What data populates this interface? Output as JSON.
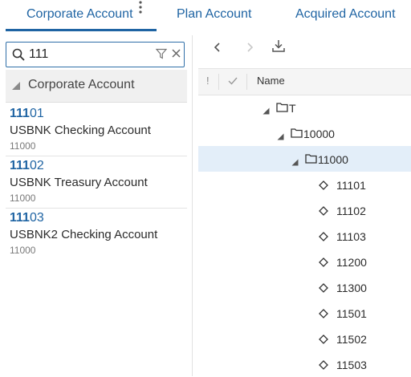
{
  "tabs": [
    {
      "label": "Corporate Account",
      "active": true
    },
    {
      "label": "Plan Account",
      "active": false
    },
    {
      "label": "Acquired Account",
      "active": false
    }
  ],
  "search": {
    "value": "111"
  },
  "left_panel": {
    "header": "Corporate Account",
    "results": [
      {
        "match": "111",
        "rest": "01",
        "name": "USBNK Checking Account",
        "parent": "11000"
      },
      {
        "match": "111",
        "rest": "02",
        "name": "USBNK Treasury Account",
        "parent": "11000"
      },
      {
        "match": "111",
        "rest": "03",
        "name": "USBNK2 Checking Account",
        "parent": "11000"
      }
    ]
  },
  "grid": {
    "col_excl": "!",
    "col_name": "Name"
  },
  "tree": [
    {
      "label": "T",
      "type": "folder",
      "level": 0,
      "selected": false
    },
    {
      "label": "10000",
      "type": "folder",
      "level": 1,
      "selected": false
    },
    {
      "label": "11000",
      "type": "folder",
      "level": 2,
      "selected": true
    },
    {
      "label": "11101",
      "type": "leaf",
      "level": 3,
      "selected": false
    },
    {
      "label": "11102",
      "type": "leaf",
      "level": 3,
      "selected": false
    },
    {
      "label": "11103",
      "type": "leaf",
      "level": 3,
      "selected": false
    },
    {
      "label": "11200",
      "type": "leaf",
      "level": 3,
      "selected": false
    },
    {
      "label": "11300",
      "type": "leaf",
      "level": 3,
      "selected": false
    },
    {
      "label": "11501",
      "type": "leaf",
      "level": 3,
      "selected": false
    },
    {
      "label": "11502",
      "type": "leaf",
      "level": 3,
      "selected": false
    },
    {
      "label": "11503",
      "type": "leaf",
      "level": 3,
      "selected": false
    }
  ],
  "colors": {
    "accent": "#1f64a3",
    "selected_row": "#e3eef9"
  },
  "icons": {
    "search": "search-icon",
    "filter": "filter-icon",
    "clear": "close-icon",
    "more": "more-vertical-icon",
    "prev": "chevron-left-icon",
    "next": "chevron-right-icon",
    "export": "download-icon",
    "folder": "folder-icon",
    "leaf": "diamond-leaf-icon",
    "expand": "triangle-expanded-icon"
  }
}
